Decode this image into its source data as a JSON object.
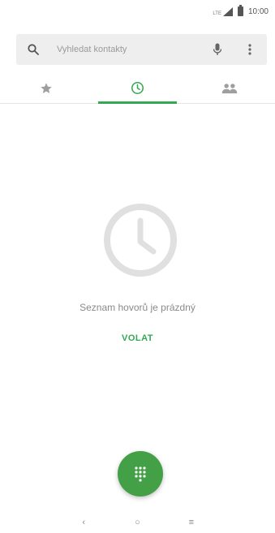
{
  "status_bar": {
    "time": "10:00",
    "network": "LTE"
  },
  "search": {
    "placeholder": "Vyhledat kontakty"
  },
  "tabs": [
    {
      "icon": "star-icon",
      "active": false
    },
    {
      "icon": "clock-icon",
      "active": true
    },
    {
      "icon": "contacts-icon",
      "active": false
    }
  ],
  "empty_state": {
    "message": "Seznam hovorů je prázdný",
    "action": "VOLAT"
  },
  "colors": {
    "accent": "#34a853",
    "fab": "#43a047",
    "empty_icon": "#e0e0e0"
  },
  "nav_bar": {
    "back": "‹",
    "home": "○",
    "recents": "≡"
  }
}
